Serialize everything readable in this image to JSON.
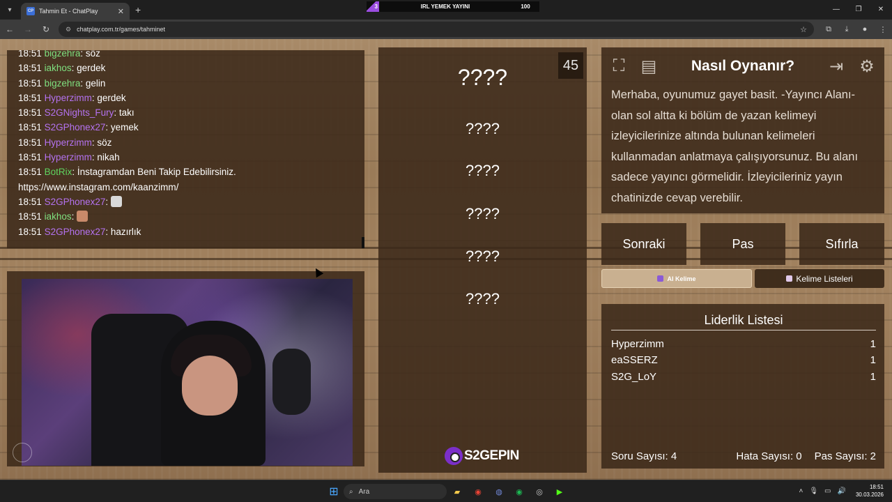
{
  "browser": {
    "tab_title": "Tahmin Et - ChatPlay",
    "tab_favicon": "CP",
    "url": "chatplay.com.tr/games/tahminet",
    "banner": {
      "left": "3",
      "title": "IRL YEMEK YAYINI",
      "right": "100"
    }
  },
  "chat": {
    "lines": [
      {
        "time": "18:51",
        "user": "bigzehra",
        "color": "#7fe07f",
        "msg": ": söz"
      },
      {
        "time": "18:51",
        "user": "iakhos",
        "color": "#7fe07f",
        "msg": ": gerdek"
      },
      {
        "time": "18:51",
        "user": "bigzehra",
        "color": "#7fe07f",
        "msg": ": gelin"
      },
      {
        "time": "18:51",
        "user": "Hyperzimm",
        "color": "#b472f0",
        "msg": ": gerdek"
      },
      {
        "time": "18:51",
        "user": "S2GNights_Fury",
        "color": "#b472f0",
        "msg": ": takı"
      },
      {
        "time": "18:51",
        "user": "S2GPhonex27",
        "color": "#b472f0",
        "msg": ": yemek"
      },
      {
        "time": "18:51",
        "user": "Hyperzimm",
        "color": "#b472f0",
        "msg": ": söz"
      },
      {
        "time": "18:51",
        "user": "Hyperzimm",
        "color": "#b472f0",
        "msg": ": nikah"
      },
      {
        "time": "18:51",
        "user": "BotRix",
        "color": "#5fd35f",
        "msg": ": İnstagramdan Beni Takip Edebilirsiniz."
      },
      {
        "time": "",
        "user": "",
        "color": "#ffffff",
        "msg": "https://www.instagram.com/kaanzimm/"
      },
      {
        "time": "18:51",
        "user": "S2GPhonex27",
        "color": "#b472f0",
        "msg": ":"
      },
      {
        "time": "18:51",
        "user": "iakhos",
        "color": "#7fe07f",
        "msg": ":"
      },
      {
        "time": "18:51",
        "user": "S2GPhonex27",
        "color": "#b472f0",
        "msg": ": hazırlık"
      }
    ]
  },
  "game": {
    "timer": "45",
    "words": [
      "????",
      "????",
      "????",
      "????",
      "????",
      "????"
    ],
    "brand": "S2GEPIN"
  },
  "howto": {
    "title": "Nasıl Oynanır?",
    "text": "Merhaba, oyunumuz gayet basit. -Yayıncı Alanı- olan sol altta ki bölüm de yazan kelimeyi izleyicilerinize altında bulunan kelimeleri kullanmadan anlatmaya çalışıyorsunuz. Bu alanı sadece yayıncı görmelidir. İzleyicileriniz yayın chatinizde cevap verebilir."
  },
  "actions": {
    "next": "Sonraki",
    "pass": "Pas",
    "reset": "Sıfırla"
  },
  "pills": {
    "ai": "AI Kelime",
    "lists": "Kelime Listeleri"
  },
  "leaderboard": {
    "title": "Liderlik Listesi",
    "rows": [
      {
        "name": "Hyperzimm",
        "score": "1"
      },
      {
        "name": "eaSSERZ",
        "score": "1"
      },
      {
        "name": "S2G_LoY",
        "score": "1"
      }
    ]
  },
  "stats": {
    "questions": "Soru Sayısı: 4",
    "errors": "Hata Sayısı: 0",
    "passes": "Pas Sayısı: 2"
  },
  "taskbar": {
    "search": "Ara",
    "time": "18:51",
    "date": "30.03.2026"
  }
}
